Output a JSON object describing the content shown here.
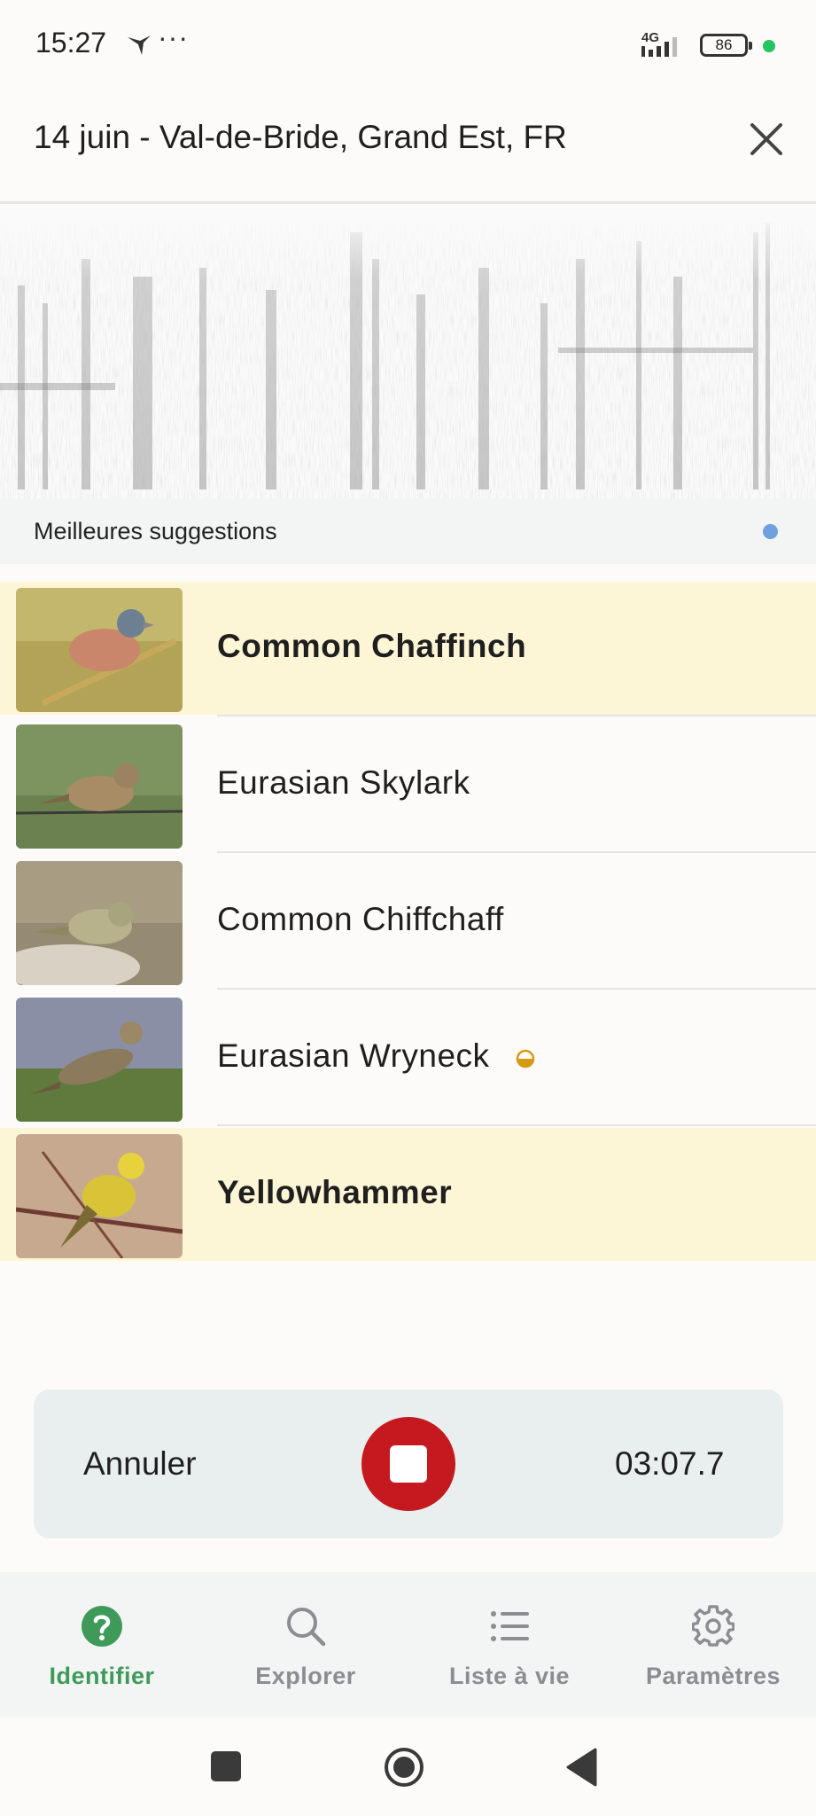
{
  "status_bar": {
    "time": "15:27",
    "dots": "···",
    "network": "4G",
    "battery": "86"
  },
  "header": {
    "title": "14 juin - Val-de-Bride, Grand Est, FR",
    "close_icon": "close-icon"
  },
  "suggestions": {
    "title": "Meilleures suggestions",
    "items": [
      {
        "name": "Common Chaffinch",
        "highlight": true
      },
      {
        "name": "Eurasian Skylark",
        "highlight": false
      },
      {
        "name": "Common Chiffchaff",
        "highlight": false
      },
      {
        "name": "Eurasian Wryneck",
        "highlight": false,
        "badge": "rare-icon"
      },
      {
        "name": "Yellowhammer",
        "highlight": true
      }
    ]
  },
  "recording": {
    "cancel_label": "Annuler",
    "timer": "03:07.7",
    "stop_icon": "stop-icon",
    "stop_color": "#c4191e"
  },
  "nav": {
    "items": [
      {
        "label": "Identifier",
        "icon": "help-circle-icon",
        "active": true
      },
      {
        "label": "Explorer",
        "icon": "search-icon",
        "active": false
      },
      {
        "label": "Liste à vie",
        "icon": "list-icon",
        "active": false
      },
      {
        "label": "Paramètres",
        "icon": "gear-icon",
        "active": false
      }
    ],
    "active_color": "#3f9a5a"
  }
}
